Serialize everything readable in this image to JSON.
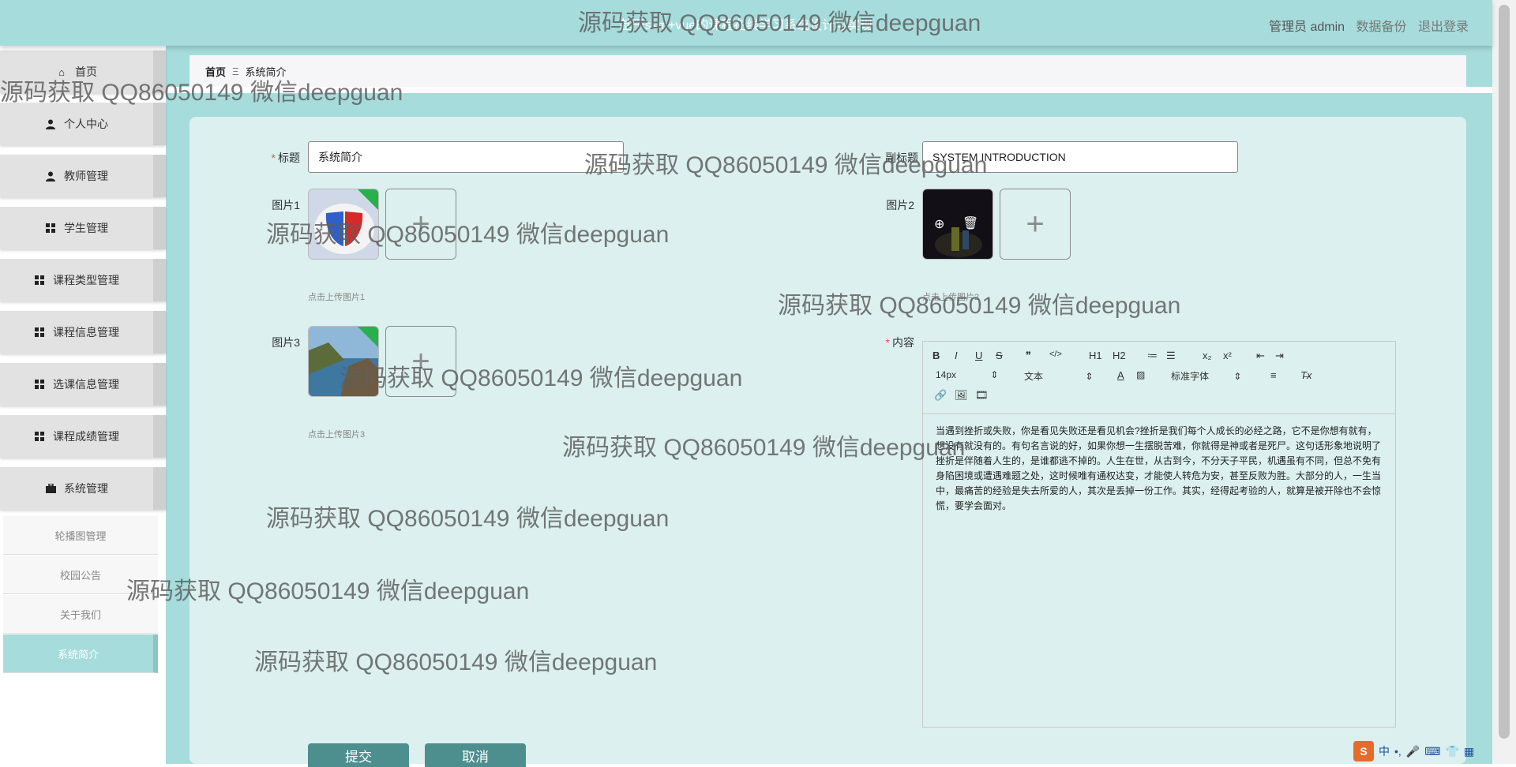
{
  "header": {
    "title": "基于ssm+vue的课程在线学习系统设计与实现",
    "user_label": "管理员 admin",
    "backup_label": "数据备份",
    "logout_label": "退出登录"
  },
  "sidebar": {
    "items": [
      {
        "label": "首页",
        "icon": "home-icon"
      },
      {
        "label": "个人中心",
        "icon": "user-icon"
      },
      {
        "label": "教师管理",
        "icon": "teacher-icon"
      },
      {
        "label": "学生管理",
        "icon": "grid-icon"
      },
      {
        "label": "课程类型管理",
        "icon": "grid-icon"
      },
      {
        "label": "课程信息管理",
        "icon": "grid-icon"
      },
      {
        "label": "选课信息管理",
        "icon": "grid-icon"
      },
      {
        "label": "课程成绩管理",
        "icon": "grid-icon"
      },
      {
        "label": "系统管理",
        "icon": "briefcase-icon"
      }
    ],
    "sub_items": [
      {
        "label": "轮播图管理"
      },
      {
        "label": "校园公告"
      },
      {
        "label": "关于我们"
      },
      {
        "label": "系统简介",
        "active": true
      }
    ]
  },
  "breadcrumb": {
    "home": "首页",
    "separator": "Ξ",
    "current": "系统简介"
  },
  "form": {
    "title_label": "标题",
    "title_value": "系统简介",
    "subtitle_label": "副标题",
    "subtitle_value": "SYSTEM INTRODUCTION",
    "image1_label": "图片1",
    "image1_hint": "点击上传图片1",
    "image2_label": "图片2",
    "image2_hint": "点击上传图片2",
    "image3_label": "图片3",
    "image3_hint": "点击上传图片3",
    "content_label": "内容",
    "content_text": "当遇到挫折或失败，你是看见失败还是看见机会?挫折是我们每个人成长的必经之路，它不是你想有就有，想没有就没有的。有句名言说的好，如果你想一生摆脱苦难，你就得是神或者是死尸。这句话形象地说明了挫折是伴随着人生的，是谁都逃不掉的。人生在世，从古到今，不分天子平民，机遇虽有不同，但总不免有身陷困境或遭遇难题之处，这时候唯有通权达变，才能使人转危为安，甚至反败为胜。大部分的人，一生当中，最痛苦的经验是失去所爱的人，其次是丢掉一份工作。其实，经得起考验的人，就算是被开除也不会惊慌，要学会面对。",
    "submit_label": "提交",
    "cancel_label": "取消"
  },
  "editor_toolbar": {
    "font_size": "14px",
    "block_format": "文本",
    "font_family": "标准字体",
    "buttons_row1": [
      "B",
      "I",
      "U",
      "S",
      "❞",
      "</>",
      "H1",
      "H2",
      "≔",
      "☰",
      "x₂",
      "x²",
      "⇤",
      "⇥"
    ],
    "buttons_row3": [
      "link-icon",
      "image-icon",
      "video-icon"
    ]
  },
  "watermark": "源码获取 QQ86050149 微信deepguan",
  "ime": {
    "logo": "S",
    "lang": "中"
  },
  "colors": {
    "accent": "#a6dcdc",
    "card": "#dbf0ef",
    "button": "#4d8f8f",
    "required": "#e65050"
  }
}
